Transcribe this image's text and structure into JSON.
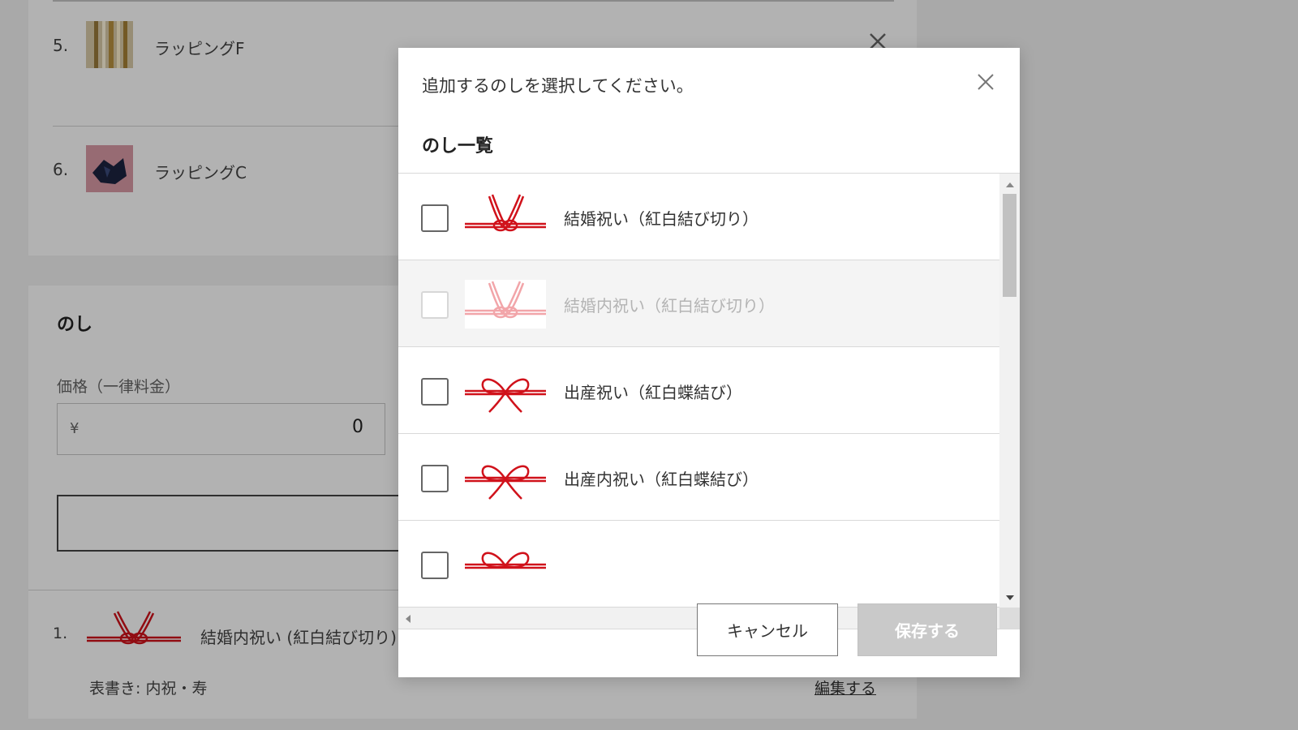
{
  "wrapping": {
    "items": [
      {
        "index": "5.",
        "name": "ラッピングF"
      },
      {
        "index": "6.",
        "name": "ラッピングC"
      }
    ]
  },
  "noshi_section": {
    "title": "のし",
    "price_label": "価格（一律料金）",
    "currency": "¥",
    "price_value": "0",
    "selected_items": [
      {
        "index": "1.",
        "name": "結婚内祝い (紅白結び切り)",
        "omotegaki": "表書き: 内祝・寿",
        "edit_label": "編集する"
      }
    ]
  },
  "modal": {
    "title": "追加するのしを選択してください。",
    "list_title": "のし一覧",
    "items": [
      {
        "label": "結婚祝い（紅白結び切り）",
        "knot": "musubikiri",
        "checked": false,
        "disabled": false
      },
      {
        "label": "結婚内祝い（紅白結び切り）",
        "knot": "musubikiri",
        "checked": false,
        "disabled": true
      },
      {
        "label": "出産祝い（紅白蝶結び）",
        "knot": "chomusubi",
        "checked": false,
        "disabled": false
      },
      {
        "label": "出産内祝い（紅白蝶結び）",
        "knot": "chomusubi",
        "checked": false,
        "disabled": false
      },
      {
        "label": "",
        "knot": "chomusubi",
        "checked": false,
        "disabled": false
      }
    ],
    "cancel_label": "キャンセル",
    "save_label": "保存する"
  },
  "colors": {
    "mizuhiki_red": "#d0121b",
    "mizuhiki_pink": "#f2a5a9",
    "overlay": "rgba(0,0,0,0.30)",
    "save_disabled_bg": "#c9c9c9"
  }
}
